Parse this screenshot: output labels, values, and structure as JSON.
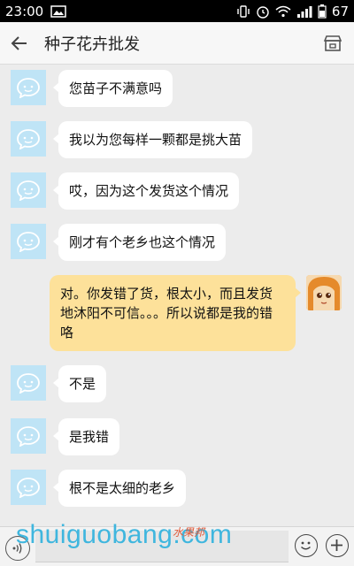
{
  "status_bar": {
    "time": "23:00",
    "battery": "67",
    "icons": [
      "image-icon",
      "vibrate-icon",
      "alarm-icon",
      "wifi-icon",
      "signal-icon",
      "battery-icon"
    ]
  },
  "header": {
    "title": "种子花卉批发",
    "back_icon": "back-arrow-icon",
    "store_icon": "store-icon"
  },
  "messages": [
    {
      "side": "left",
      "text": "您苗子不满意吗"
    },
    {
      "side": "left",
      "text": "我以为您每样一颗都是挑大苗"
    },
    {
      "side": "left",
      "text": "哎，因为这个发货这个情况"
    },
    {
      "side": "left",
      "text": "刚才有个老乡也这个情况"
    },
    {
      "side": "right",
      "text": "对。你发错了货，根太小，而且发货地沐阳不可信。。。所以说都是我的错咯"
    },
    {
      "side": "left",
      "text": "不是"
    },
    {
      "side": "left",
      "text": "是我错"
    },
    {
      "side": "left",
      "text": "根不是太细的老乡"
    }
  ],
  "input_bar": {
    "value": "",
    "voice_icon": "voice-icon",
    "emoji_icon": "emoji-icon",
    "plus_icon": "plus-icon"
  },
  "watermark": {
    "text": "shuiguobang.com",
    "subtext": "水果邦"
  },
  "colors": {
    "other_avatar": "#bfe4f6",
    "my_bubble": "#fde19a",
    "other_bubble": "#ffffff",
    "background": "#ececec",
    "watermark": "#3fb6de"
  }
}
